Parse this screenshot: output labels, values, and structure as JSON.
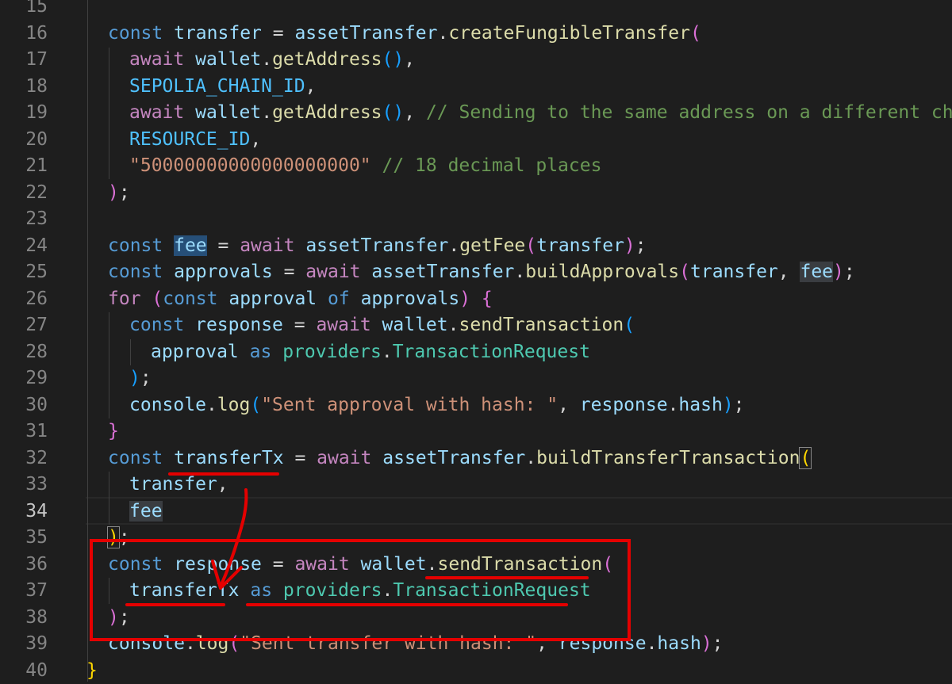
{
  "gutter": {
    "line_numbers": [
      "15",
      "16",
      "17",
      "18",
      "19",
      "20",
      "21",
      "22",
      "23",
      "24",
      "25",
      "26",
      "27",
      "28",
      "29",
      "30",
      "31",
      "32",
      "33",
      "34",
      "35",
      "36",
      "37",
      "38",
      "39",
      "40"
    ],
    "active_line": "34"
  },
  "code": {
    "l16": [
      "const",
      "transfer",
      " = ",
      "assetTransfer",
      ".",
      "createFungibleTransfer",
      "("
    ],
    "l17": [
      "await",
      " ",
      "wallet",
      ".",
      "getAddress",
      "()",
      ","
    ],
    "l18": [
      "SEPOLIA_CHAIN_ID",
      ","
    ],
    "l19": [
      "await",
      " ",
      "wallet",
      ".",
      "getAddress",
      "()",
      ", ",
      "// Sending to the same address on a different chain"
    ],
    "l20": [
      "RESOURCE_ID",
      ","
    ],
    "l21": [
      "\"50000000000000000000\"",
      " ",
      "// 18 decimal places"
    ],
    "l22": [
      ")",
      ";"
    ],
    "l24": [
      "const",
      " ",
      "fee",
      " = ",
      "await",
      " ",
      "assetTransfer",
      ".",
      "getFee",
      "(",
      "transfer",
      ")",
      ";"
    ],
    "l25": [
      "const",
      " ",
      "approvals",
      " = ",
      "await",
      " ",
      "assetTransfer",
      ".",
      "buildApprovals",
      "(",
      "transfer",
      ", ",
      "fee",
      ")",
      ";"
    ],
    "l26": [
      "for",
      " ",
      "(",
      "const",
      " ",
      "approval",
      " ",
      "of",
      " ",
      "approvals",
      ")",
      " ",
      "{"
    ],
    "l27": [
      "const",
      " ",
      "response",
      " = ",
      "await",
      " ",
      "wallet",
      ".",
      "sendTransaction",
      "("
    ],
    "l28": [
      "approval",
      " ",
      "as",
      " ",
      "providers",
      ".",
      "TransactionRequest"
    ],
    "l29": [
      ")",
      ";"
    ],
    "l30": [
      "console",
      ".",
      "log",
      "(",
      "\"Sent approval with hash: \"",
      ", ",
      "response",
      ".",
      "hash",
      ")",
      ";"
    ],
    "l31": [
      "}"
    ],
    "l32": [
      "const",
      " ",
      "transferTx",
      " = ",
      "await",
      " ",
      "assetTransfer",
      ".",
      "buildTransferTransaction",
      "("
    ],
    "l33": [
      "transfer",
      ","
    ],
    "l34": [
      "fee"
    ],
    "l35": [
      ")",
      ";"
    ],
    "l36": [
      "const",
      " ",
      "response",
      " = ",
      "await",
      " ",
      "wallet",
      ".",
      "sendTransaction",
      "("
    ],
    "l37": [
      "transferTx",
      " ",
      "as",
      " ",
      "providers",
      ".",
      "TransactionRequest"
    ],
    "l38": [
      ")",
      ";"
    ],
    "l39": [
      "console",
      ".",
      "log",
      "(",
      "\"Sent transfer with hash: \"",
      ", ",
      "response",
      ".",
      "hash",
      ")",
      ";"
    ],
    "l40": [
      "}"
    ]
  },
  "colors": {
    "background": "#1e1e1e",
    "annotation": "#e50000",
    "selection": "#264f78"
  }
}
